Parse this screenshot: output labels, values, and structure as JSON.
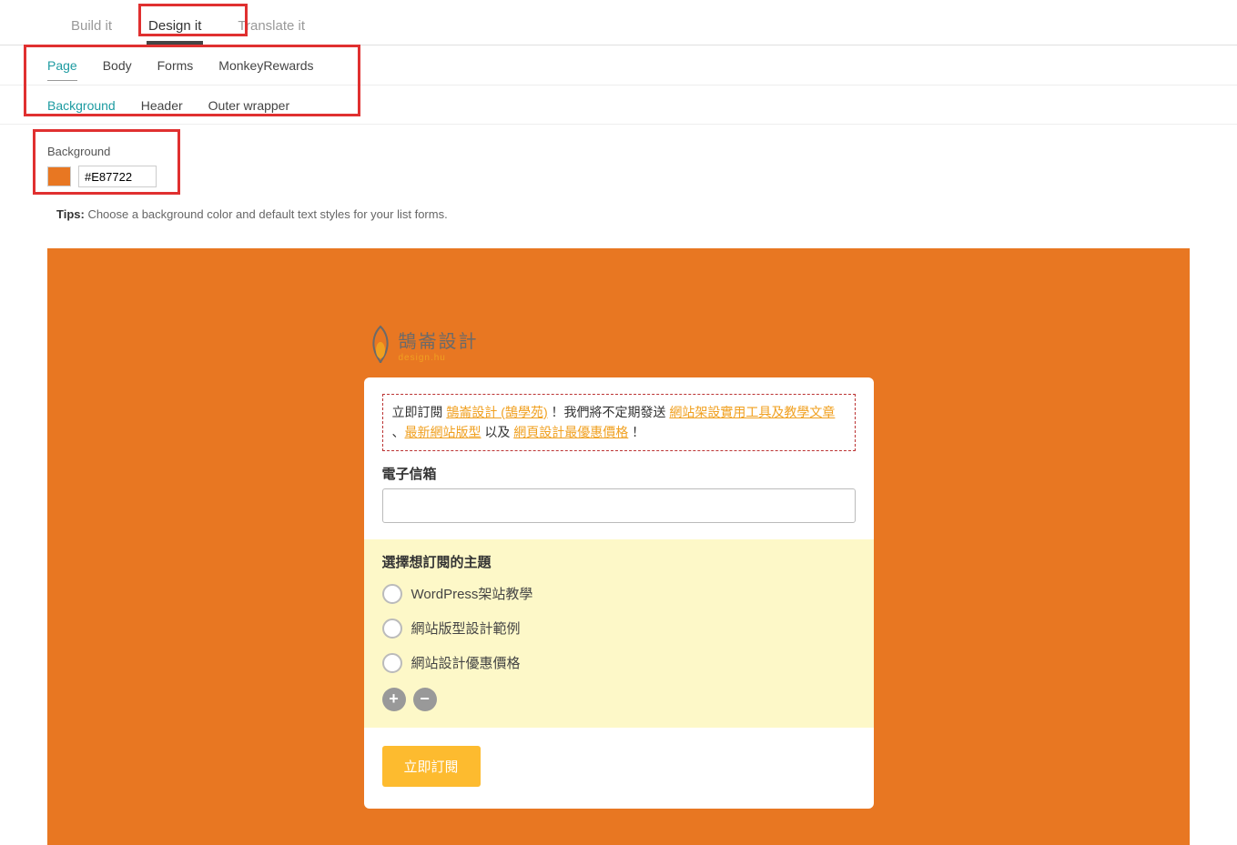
{
  "mainTabs": {
    "build": "Build it",
    "design": "Design it",
    "translate": "Translate it"
  },
  "subTabs1": {
    "page": "Page",
    "body": "Body",
    "forms": "Forms",
    "monkey": "MonkeyRewards"
  },
  "subTabs2": {
    "bg": "Background",
    "header": "Header",
    "outer": "Outer wrapper"
  },
  "bgSection": {
    "label": "Background",
    "hex": "#E87722"
  },
  "tips": {
    "label": "Tips:",
    "text": " Choose a background color and default text styles for your list forms."
  },
  "logo": {
    "cn": "鵠崙設計",
    "en": "design.hu"
  },
  "intro": {
    "t1": "立即訂閱 ",
    "a1": "鵠崙設計 (鵠學苑)",
    "t2": " ！我們將不定期發送 ",
    "a2": "網站架設實用工具及教學文章",
    "t3": " 、",
    "a3": "最新網站版型",
    "t4": " 以及 ",
    "a4": "網頁設計最優惠價格",
    "t5": " ！"
  },
  "emailLabel": "電子信箱",
  "radioTitle": "選擇想訂閱的主題",
  "radios": {
    "r1": "WordPress架站教學",
    "r2": "網站版型設計範例",
    "r3": "網站設計優惠價格"
  },
  "pm": {
    "plus": "+",
    "minus": "−"
  },
  "submit": "立即訂閱"
}
